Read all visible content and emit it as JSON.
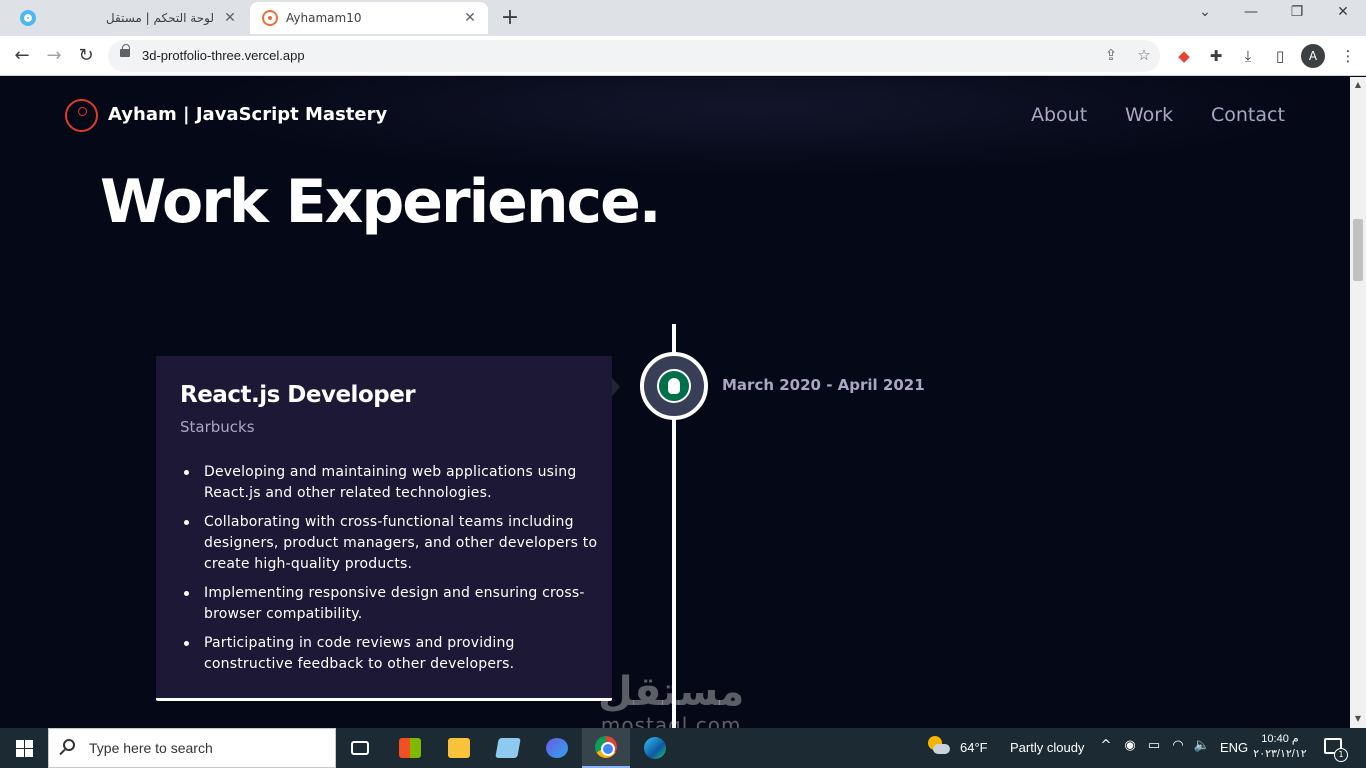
{
  "browser": {
    "tabs": [
      {
        "title": "لوحة التحكم | مستقل",
        "active": false
      },
      {
        "title": "Ayhamam10",
        "active": true
      }
    ],
    "url": "3d-protfolio-three.vercel.app",
    "profile_initial": "A",
    "icons": {
      "close": "✕",
      "new_tab": "+",
      "minimize": "—",
      "chevron": "⌄",
      "restore": "❐",
      "back": "←",
      "forward": "→",
      "reload": "↻",
      "share": "⇪",
      "star": "☆",
      "extension": "✚",
      "download": "⤓",
      "sidepanel": "▯"
    }
  },
  "site": {
    "brand": "Ayham  | JavaScript Mastery",
    "nav": [
      "About",
      "Work",
      "Contact"
    ],
    "heading": "Work Experience.",
    "experience": {
      "title": "React.js Developer",
      "company": "Starbucks",
      "date": "March 2020 - April 2021",
      "points": [
        "Developing and maintaining web applications using React.js and other related technologies.",
        "Collaborating with cross-functional teams including designers, product managers, and other developers to create high-quality products.",
        "Implementing responsive design and ensuring cross-browser compatibility.",
        "Participating in code reviews and providing constructive feedback to other developers."
      ]
    },
    "colors": {
      "background": "#050816",
      "card": "#1d1836",
      "secondary_text": "#aaa6c3",
      "logo_accent": "#e23a2a"
    }
  },
  "watermark": {
    "arabic": "مستقل",
    "latin": "mostaql.com"
  },
  "taskbar": {
    "search_placeholder": "Type here to search",
    "weather": {
      "temp": "64°F",
      "condition": "Partly cloudy"
    },
    "language": "ENG",
    "time": "10:40 م",
    "date": "٢٠٢٣/١٢/١٢",
    "notification_count": "1",
    "tray_icons": {
      "chevron_up": "^",
      "wifi": "◠",
      "battery": "▭",
      "volume": "🔈",
      "meet": "◉"
    }
  }
}
